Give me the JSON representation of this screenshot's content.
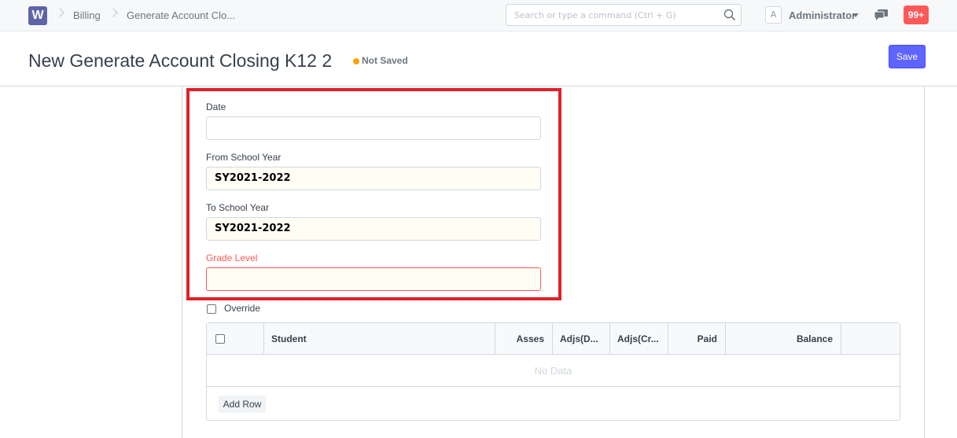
{
  "navbar": {
    "logo": "W",
    "breadcrumbs": [
      "Billing",
      "Generate Account Clo..."
    ],
    "search_placeholder": "Search or type a command (Ctrl + G)",
    "avatar_letter": "A",
    "user_name": "Administrator",
    "notification_count": "99+"
  },
  "page": {
    "title": "New Generate Account Closing K12 2",
    "status": "Not Saved",
    "save_label": "Save"
  },
  "form": {
    "date_label": "Date",
    "date_value": "",
    "from_year_label": "From School Year",
    "from_year_value": "SY2021-2022",
    "to_year_label": "To School Year",
    "to_year_value": "SY2021-2022",
    "grade_level_label": "Grade Level",
    "grade_level_value": "",
    "override_label": "Override"
  },
  "grid": {
    "columns": [
      "Student",
      "Asses",
      "Adjs(D...",
      "Adjs(Cr...",
      "Paid",
      "Balance"
    ],
    "empty_text": "No Data",
    "add_row_label": "Add Row"
  },
  "colors": {
    "primary": "#5e64ff",
    "status_dot": "#ffa00a",
    "error": "#ff5858",
    "highlight": "#e0212a"
  }
}
